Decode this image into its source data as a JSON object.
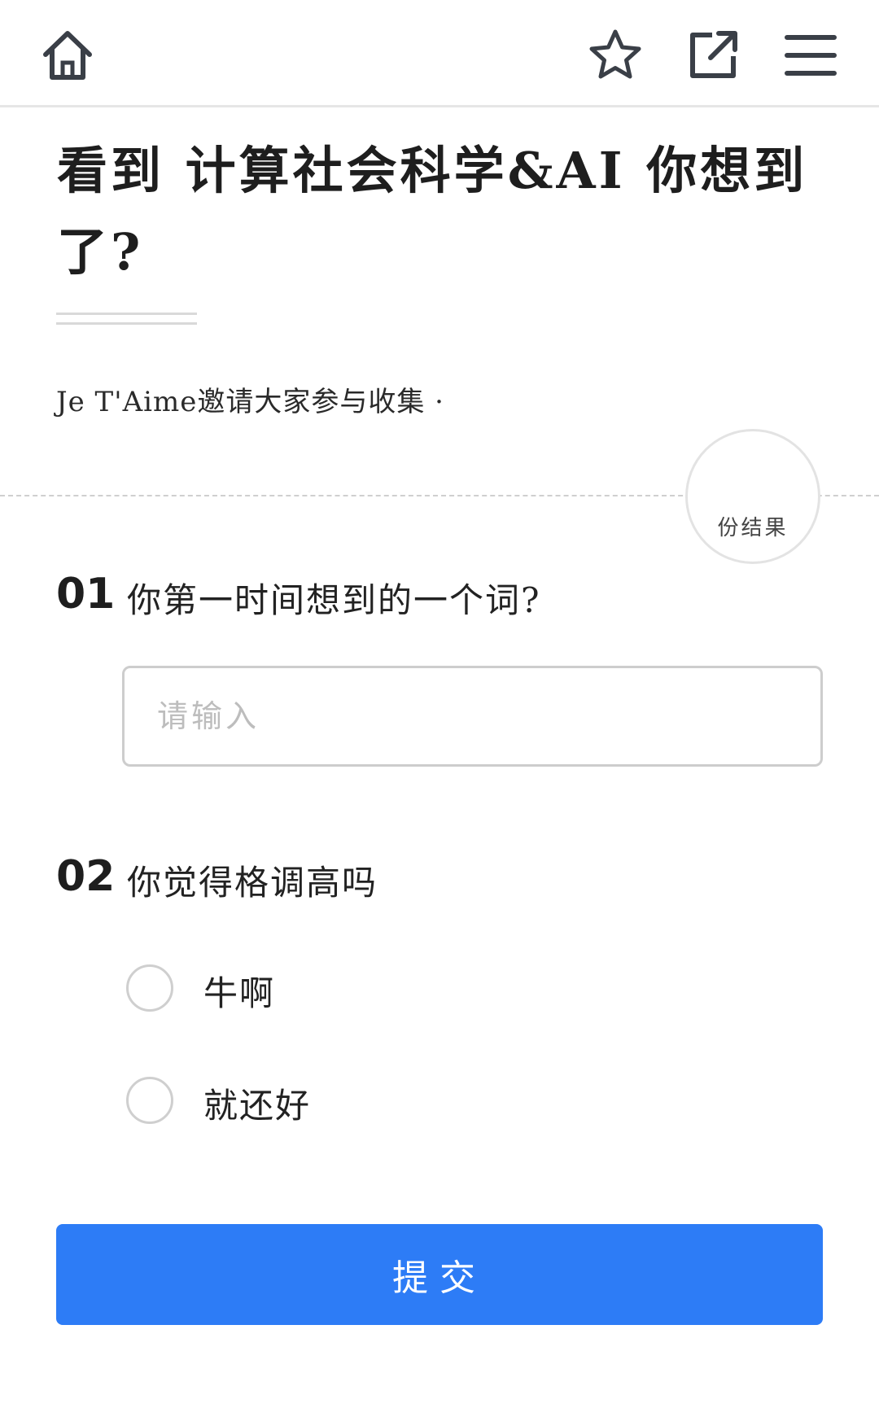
{
  "header": {
    "icons": [
      "home-icon",
      "star-icon",
      "share-icon",
      "menu-icon"
    ]
  },
  "form": {
    "title_line1": "看到 计算社会科学&AI 你想到",
    "title_line2": "了?",
    "subtitle": "Je T'Aime邀请大家参与收集 ·",
    "result_badge": "份结果"
  },
  "questions": [
    {
      "number": "01",
      "text": "你第一时间想到的一个词?",
      "type": "text",
      "placeholder": "请输入",
      "value": ""
    },
    {
      "number": "02",
      "text": "你觉得格调高吗",
      "type": "radio",
      "options": [
        {
          "label": "牛啊",
          "selected": false
        },
        {
          "label": "就还好",
          "selected": false
        }
      ]
    }
  ],
  "submit_label": "提交",
  "colors": {
    "accent": "#2d7cf6",
    "icon": "#3a3f47",
    "border": "#cdcdcd"
  }
}
